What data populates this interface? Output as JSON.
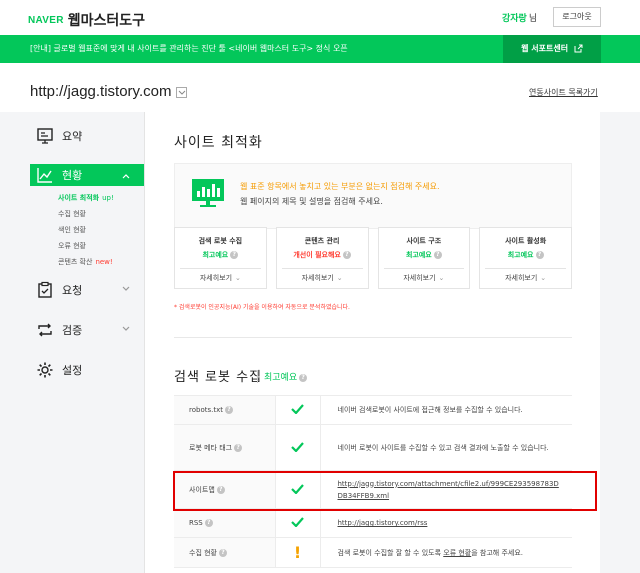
{
  "header": {
    "brand": "NAVER",
    "service": "웹마스터도구",
    "user_name": "강자랑",
    "user_suffix": "님",
    "logout_label": "로그아웃"
  },
  "notice": {
    "text": "[안내] 글로벌 웹표준에 맞게 내 사이트를 관리하는 진단 툴 <네이버 웹마스터 도구> 정식 오픈",
    "support_label": "웹 서포트센터"
  },
  "site": {
    "url": "http://jagg.tistory.com",
    "list_link": "연동사이트 목록가기"
  },
  "sidebar": {
    "items": [
      {
        "label": "요약",
        "icon": "summary-icon"
      },
      {
        "label": "현황",
        "icon": "chart-icon",
        "active": true,
        "sub": [
          {
            "label": "사이트 최적화",
            "badge": "up!",
            "active": true
          },
          {
            "label": "수집 현황"
          },
          {
            "label": "색인 현황"
          },
          {
            "label": "오류 현황"
          },
          {
            "label": "콘텐츠 확산",
            "badge": "new!"
          }
        ]
      },
      {
        "label": "요청",
        "icon": "clipboard-icon"
      },
      {
        "label": "검증",
        "icon": "refresh-icon"
      },
      {
        "label": "설정",
        "icon": "gear-icon"
      }
    ]
  },
  "optimization": {
    "title": "사이트 최적화",
    "message_1": "웹 표준 항목에서 놓치고 있는 부분은 없는지 점검해 주세요.",
    "message_2": "웹 페이지의 제목 및 설명을 점검해 주세요.",
    "cards": [
      {
        "title": "검색 로봇 수집",
        "status": "최고예요",
        "status_type": "good",
        "detail": "자세히보기"
      },
      {
        "title": "콘텐츠 관리",
        "status": "개선이 필요해요",
        "status_type": "bad",
        "detail": "자세히보기"
      },
      {
        "title": "사이트 구조",
        "status": "최고예요",
        "status_type": "good",
        "detail": "자세히보기"
      },
      {
        "title": "사이트 활성화",
        "status": "최고예요",
        "status_type": "good",
        "detail": "자세히보기"
      }
    ],
    "footnote": "* 검색로봇이 인공지능(AI) 기술을 이용하여 자동으로 분석하였습니다."
  },
  "crawl": {
    "title": "검색 로봇 수집",
    "status": "최고예요",
    "rows": [
      {
        "label": "robots.txt",
        "mark": "check",
        "text": "네이버 검색로봇이 사이트에 접근해 정보를 수집할 수 있습니다."
      },
      {
        "label": "로봇 메타 태그",
        "mark": "check",
        "text": "네이버 로봇이 사이트를 수집할 수 있고 검색 결과에 노출할 수 있습니다."
      },
      {
        "label": "사이트맵",
        "mark": "check",
        "link": "http://jagg.tistory.com/attachment/cfile2.uf/999CE293598783DDB34FFB9.xml"
      },
      {
        "label": "RSS",
        "mark": "check",
        "link": "http://jagg.tistory.com/rss"
      },
      {
        "label": "수집 현황",
        "mark": "warn",
        "text_before": "검색 로봇이 수집할 잘 할 수 있도록 ",
        "text_link": "오류 현황",
        "text_after": "을 참고해 주세요."
      }
    ]
  },
  "colors": {
    "brand_green": "#03c75a",
    "warning_orange": "#f59b00",
    "error_red": "#ff3b30",
    "highlight_red": "#e10000"
  }
}
